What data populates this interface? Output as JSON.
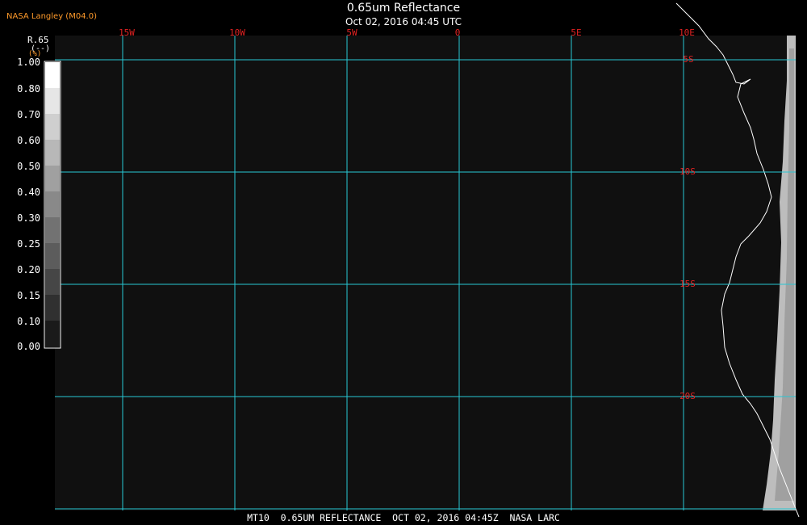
{
  "header": {
    "org": "NASA Langley (M04.0)",
    "title": "0.65um Reflectance",
    "subtitle": "Oct 02, 2016 04:45 UTC"
  },
  "footer": "MT10  0.65UM REFLECTANCE  OCT 02, 2016 04:45Z  NASA LARC",
  "legend": {
    "title": "R.65",
    "units": "(--)",
    "units_prefix": "(%)",
    "labels": [
      "1.00",
      "0.80",
      "0.70",
      "0.60",
      "0.50",
      "0.40",
      "0.30",
      "0.25",
      "0.20",
      "0.15",
      "0.10",
      "0.00"
    ]
  },
  "grid": {
    "longitudes": [
      "15W",
      "10W",
      "5W",
      "0",
      "5E",
      "10E"
    ],
    "latitudes": [
      "5S",
      "10S",
      "15S",
      "20S"
    ]
  },
  "colors": {
    "grid": "#27c7d4",
    "grid_label": "#e22222",
    "background": "#101010",
    "coast": "#ffffff"
  }
}
